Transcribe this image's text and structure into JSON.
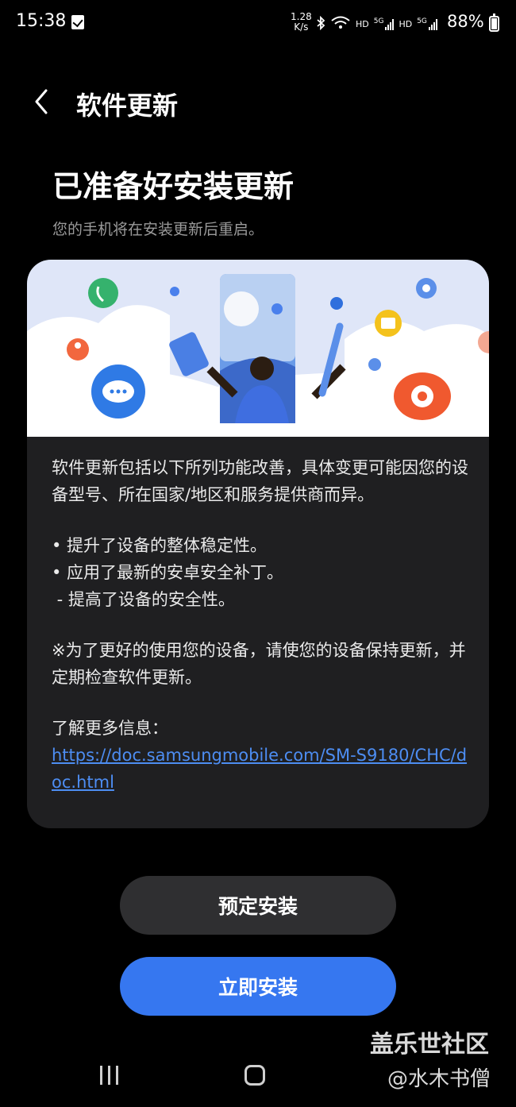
{
  "status_bar": {
    "time": "15:38",
    "net_speed_value": "1.28",
    "net_speed_unit": "K/s",
    "hd1": "HD",
    "sig1_label": "5G",
    "hd2": "HD",
    "sig2_label": "5G",
    "battery": "88%"
  },
  "header": {
    "back_icon": "chevron-left-icon",
    "title": "软件更新"
  },
  "main": {
    "headline": "已准备好安装更新",
    "subtitle": "您的手机将在安装更新后重启。"
  },
  "card": {
    "intro": "软件更新包括以下所列功能改善，具体变更可能因您的设备型号、所在国家/地区和服务提供商而异。",
    "bullet1": "• 提升了设备的整体稳定性。",
    "bullet2": "• 应用了最新的安卓安全补丁。",
    "bullet3": " - 提高了设备的安全性。",
    "note": "※为了更好的使用您的设备，请使您的设备保持更新，并定期检查软件更新。",
    "more_label": "了解更多信息：",
    "more_link": "https://doc.samsungmobile.com/SM-S9180/CHC/doc.html"
  },
  "buttons": {
    "schedule": "预定安装",
    "install_now": "立即安装"
  },
  "watermark": {
    "line1": "盖乐世社区",
    "line2": "@水木书僧"
  },
  "colors": {
    "background": "#000000",
    "card": "#1f1f21",
    "accent": "#3677f0",
    "link": "#4d8df2",
    "secondary_button": "#2f2f31"
  }
}
